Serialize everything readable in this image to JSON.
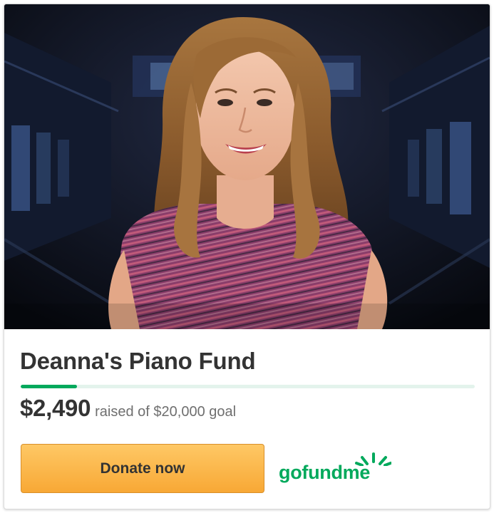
{
  "campaign": {
    "title": "Deanna's Piano Fund",
    "raised_amount": "$2,490",
    "goal_text": "raised of $20,000 goal",
    "progress_fraction": 0.1245
  },
  "actions": {
    "donate_label": "Donate now"
  },
  "brand": {
    "logo_text": "gofundme",
    "accent_color": "#02a95c",
    "button_color": "#f8a835"
  },
  "icons": {
    "logo_mark": "gofundme-sunburst-icon"
  }
}
